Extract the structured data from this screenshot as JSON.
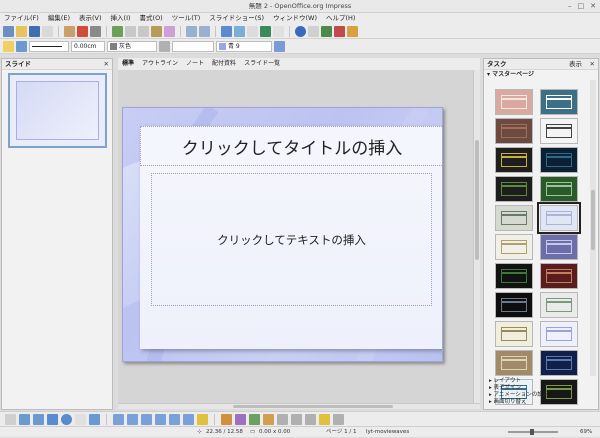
{
  "window": {
    "title": "無題 2 - OpenOffice.org Impress"
  },
  "menu": [
    "ファイル(F)",
    "編集(E)",
    "表示(V)",
    "挿入(I)",
    "書式(O)",
    "ツール(T)",
    "スライドショー(S)",
    "ウィンドウ(W)",
    "ヘルプ(H)"
  ],
  "format_bar": {
    "line_width": "0.00cm",
    "line_color": "灰色",
    "fill_color": "青 9"
  },
  "slides_pane": {
    "title": "スライド",
    "slide_number": "1"
  },
  "view_tabs": [
    "標準",
    "アウトライン",
    "ノート",
    "配付資料",
    "スライド一覧"
  ],
  "slide": {
    "title_placeholder": "クリックしてタイトルの挿入",
    "text_placeholder": "クリックしてテキストの挿入"
  },
  "tasks_pane": {
    "title": "タスク",
    "view_menu": "表示",
    "master_section": "マスターページ",
    "sections": [
      "レイアウト",
      "表デザイン",
      "アニメーションの設定",
      "画面切り替え"
    ]
  },
  "status": {
    "position": "22.36 / 12.58",
    "size": "0.00 x 0.00",
    "page": "ページ 1 / 1",
    "master": "lyt-moviewaves",
    "zoom": "69%"
  },
  "colors": {
    "gray": "#808080",
    "blue9": "#99a6e0"
  },
  "templates": [
    {
      "bg": "#d9a9a0",
      "fg": "#f1e6e0",
      "dark": false
    },
    {
      "bg": "#3d6f86",
      "fg": "#ffffff",
      "dark": false
    },
    {
      "bg": "#6c4a40",
      "fg": "#a56c5a",
      "dark": true
    },
    {
      "bg": "#f4f4f4",
      "fg": "#444444",
      "dark": false
    },
    {
      "bg": "#1e1e1e",
      "fg": "#c8b040",
      "dark": true
    },
    {
      "bg": "#0d2033",
      "fg": "#2c6b8c",
      "dark": true
    },
    {
      "bg": "#1d1d1d",
      "fg": "#5a8a3a",
      "dark": true
    },
    {
      "bg": "#2a5a2a",
      "fg": "#9ac49a",
      "dark": true
    },
    {
      "bg": "#d6d9d0",
      "fg": "#6a7a6a",
      "dark": false
    },
    {
      "bg": "#dfe6f4",
      "fg": "#aab4d6",
      "dark": false,
      "sel": true
    },
    {
      "bg": "#f1efe6",
      "fg": "#b0a070",
      "dark": false
    },
    {
      "bg": "#6b6ea8",
      "fg": "#c7c9ec",
      "dark": false
    },
    {
      "bg": "#121212",
      "fg": "#3a7a3a",
      "dark": true
    },
    {
      "bg": "#5a1c1c",
      "fg": "#c08060",
      "dark": true
    },
    {
      "bg": "#0e0e0e",
      "fg": "#6a7a8a",
      "dark": true
    },
    {
      "bg": "#eaeaea",
      "fg": "#7a9a7a",
      "dark": false
    },
    {
      "bg": "#f0eedd",
      "fg": "#9a8a5a",
      "dark": false
    },
    {
      "bg": "#eef0fb",
      "fg": "#9aa4d8",
      "dark": false
    },
    {
      "bg": "#a08a6a",
      "fg": "#e0d4b6",
      "dark": false
    },
    {
      "bg": "#10204a",
      "fg": "#5a7ab0",
      "dark": true
    },
    {
      "bg": "#eaf2f6",
      "fg": "#3a6a8a",
      "dark": false
    },
    {
      "bg": "#171717",
      "fg": "#7a9a4a",
      "dark": true
    }
  ]
}
